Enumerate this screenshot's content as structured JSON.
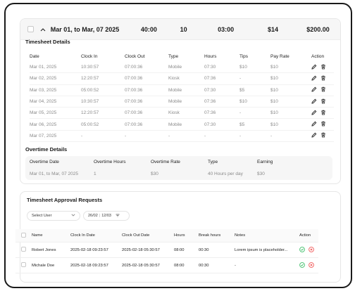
{
  "summary": {
    "date_range": "Mar 01, to Mar, 07 2025",
    "clock_in": "40:00",
    "days": "10",
    "hours": "03:00",
    "tips": "$14",
    "total": "$200.00"
  },
  "timesheet": {
    "title": "Timesheet Details",
    "columns": [
      "Date",
      "Clock In",
      "Clock Out",
      "Type",
      "Hours",
      "Tips",
      "Pay Rate",
      "Action"
    ],
    "rows": [
      {
        "date": "Mar 01, 2025",
        "clock_in": "10:30:57",
        "clock_out": "07:00:36",
        "type": "Mobile",
        "hours": "07:30",
        "tips": "$10",
        "pay_rate": "$10"
      },
      {
        "date": "Mar 02, 2025",
        "clock_in": "12:20:57",
        "clock_out": "07:00:36",
        "type": "Kiosk",
        "hours": "07:36",
        "tips": "-",
        "pay_rate": "$10"
      },
      {
        "date": "Mar 03, 2025",
        "clock_in": "05:00:52",
        "clock_out": "07:00:36",
        "type": "Mobile",
        "hours": "07:30",
        "tips": "$5",
        "pay_rate": "$10"
      },
      {
        "date": "Mar 04, 2025",
        "clock_in": "10:30:57",
        "clock_out": "07:00:36",
        "type": "Mobile",
        "hours": "07:36",
        "tips": "$10",
        "pay_rate": "$10"
      },
      {
        "date": "Mar 05, 2025",
        "clock_in": "12:20:57",
        "clock_out": "07:00:36",
        "type": "Kiosk",
        "hours": "07:36",
        "tips": "-",
        "pay_rate": "$10"
      },
      {
        "date": "Mar 06, 2025",
        "clock_in": "05:00:52",
        "clock_out": "07:00:36",
        "type": "Mobile",
        "hours": "07:30",
        "tips": "$5",
        "pay_rate": "$10"
      },
      {
        "date": "Mar 07, 2025",
        "clock_in": "-",
        "clock_out": "-",
        "type": "-",
        "hours": "-",
        "tips": "-",
        "pay_rate": "-"
      }
    ]
  },
  "overtime": {
    "title": "Overtime Details",
    "columns": [
      "Overtime Date",
      "Overtime Hours",
      "Overtime Rate",
      "Type",
      "Earning"
    ],
    "row": {
      "date": "Mar 01, to Mar, 07 2025",
      "hours": "1",
      "rate": "$30",
      "type": "40 Hours per day",
      "earning": "$30"
    }
  },
  "approval": {
    "title": "Timesheet Approval Requests",
    "select_user": "Select User",
    "date_from": "26/02",
    "date_to": "12/03",
    "date_sep": "|",
    "columns": [
      "Name",
      "Clock In Date",
      "Clock Out Date",
      "Hours",
      "Break hours",
      "Notes",
      "Action"
    ],
    "rows": [
      {
        "name": "Robert Jones",
        "clock_in": "2025-02-18 09:23:57",
        "clock_out": "2025-02-18 05:30:57",
        "hours": "08:00",
        "break": "00:30",
        "notes": "Lorem ipsum is placeholder..."
      },
      {
        "name": "Michale Doe",
        "clock_in": "2025-02-18 09:23:57",
        "clock_out": "2025-02-18 05:30:57",
        "hours": "08:00",
        "break": "00:30",
        "notes": "-"
      }
    ]
  },
  "colors": {
    "approve": "#3fbf6a",
    "reject": "#f05a5a",
    "muted": "#8a8a8a"
  }
}
